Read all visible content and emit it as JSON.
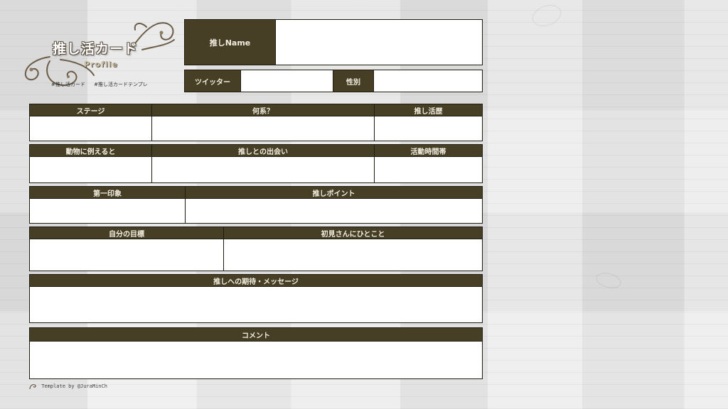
{
  "logo": {
    "title": "推し活カード",
    "subtitle": "Profile",
    "hashtags": [
      "#推し活カード",
      "#推し活カードテンプレ"
    ]
  },
  "top_fields": {
    "name_label": "推しName",
    "twitter_label": "ツイッター",
    "gender_label": "性別"
  },
  "row1": {
    "stage": "ステージ",
    "type": "何系？",
    "history": "推し活歴"
  },
  "row2": {
    "animal": "動物に例えると",
    "meeting": "推しとの出会い",
    "active_time": "活動時間帯"
  },
  "row3": {
    "first_impression": "第一印象",
    "oshi_point": "推しポイント"
  },
  "row4": {
    "goal": "自分の目標",
    "greeting": "初見さんにひとこと"
  },
  "row5": {
    "message": "推しへの期待・メッセージ"
  },
  "row6": {
    "comment": "コメント"
  },
  "credit": "Template by @JuraMinCh",
  "colors": {
    "header_bg": "#463f26",
    "header_text": "#f2ede0",
    "border": "#1e1b12",
    "background": "#e7e7e7"
  }
}
